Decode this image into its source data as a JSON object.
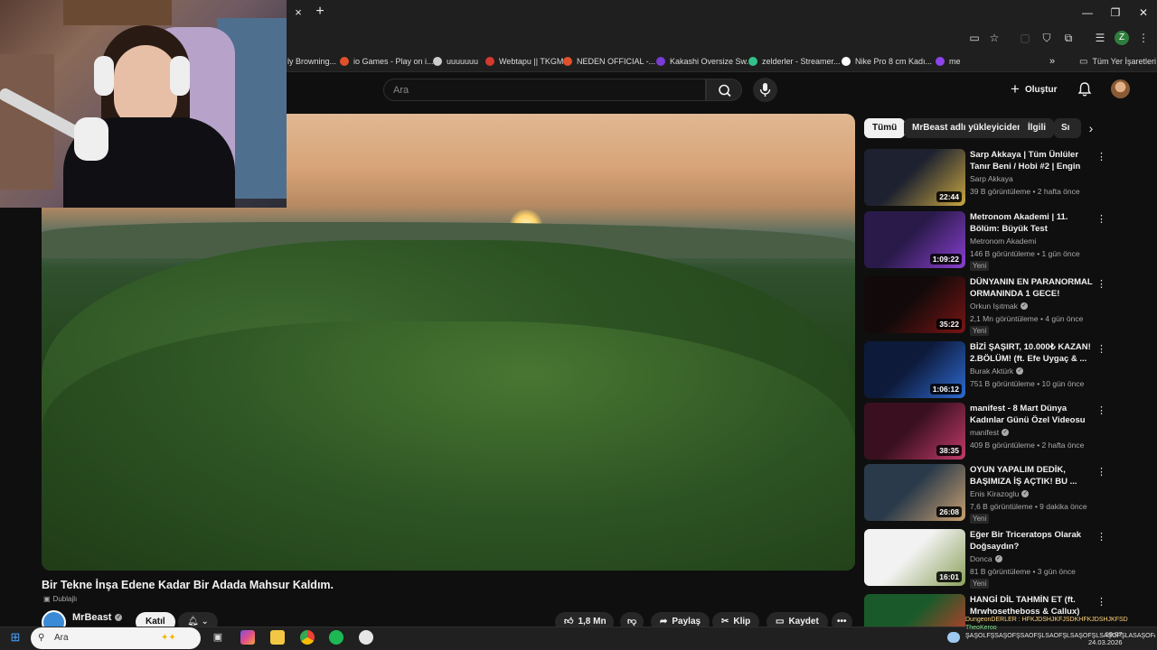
{
  "browser": {
    "tab_close": "×",
    "tab_new": "+",
    "bookmarks": [
      {
        "label": "ly Browning...",
        "color": "#777777"
      },
      {
        "label": "io Games - Play on i...",
        "color": "#e0502a"
      },
      {
        "label": "uuuuuuu",
        "color": "#cccccc"
      },
      {
        "label": "Webtapu || TKGM",
        "color": "#d33a2c"
      },
      {
        "label": "NEDEN OFFICIAL -...",
        "color": "#e0502a"
      },
      {
        "label": "Kakashi Oversize Sw...",
        "color": "#7a3bd6"
      },
      {
        "label": "zelderler - Streamer...",
        "color": "#35c08a"
      },
      {
        "label": "Nike Pro 8 cm Kadı...",
        "color": "#ffffff"
      },
      {
        "label": "me",
        "color": "#8e44ec"
      }
    ],
    "bookmarks_overflow": "»",
    "all_bookmarks": "Tüm Yer İşaretleri",
    "profile_initial": "Z"
  },
  "header": {
    "search_placeholder": "Ara",
    "create_label": "Oluştur"
  },
  "chips": [
    "Tümü",
    "MrBeast adlı yükleyiciden",
    "İlgili",
    "Sı"
  ],
  "recommendations": [
    {
      "title": "Sarp Akkaya | Tüm Ünlüler Tanır Beni / Hobi #2 | Engin Öztürk il...",
      "channel": "Sarp Akkaya",
      "verified": false,
      "meta": "39 B görüntüleme • 2 hafta önce",
      "badge": "",
      "duration": "22:44",
      "thumb_a": "#1e2230",
      "thumb_b": "#c9a640"
    },
    {
      "title": "Metronom Akademi | 11. Bölüm: Büyük Test",
      "channel": "Metronom Akademi",
      "verified": false,
      "meta": "146 B görüntüleme • 1 gün önce",
      "badge": "Yeni",
      "duration": "1:09:22",
      "thumb_a": "#2a1a4a",
      "thumb_b": "#8a3fd1"
    },
    {
      "title": "DÜNYANIN EN PARANORMAL ORMANINDA 1 GECE!",
      "channel": "Orkun Işıtmak",
      "verified": true,
      "meta": "2,1 Mn görüntüleme • 4 gün önce",
      "badge": "Yeni",
      "duration": "35:22",
      "thumb_a": "#120a0a",
      "thumb_b": "#7a1414"
    },
    {
      "title": "BİZİ ŞAŞIRT, 10.000₺ KAZAN! 2.BÖLÜM! (ft. Efe Uygaç & ...",
      "channel": "Burak Aktürk",
      "verified": true,
      "meta": "751 B görüntüleme • 10 gün önce",
      "badge": "",
      "duration": "1:06:12",
      "thumb_a": "#0d1a3a",
      "thumb_b": "#2e6ad1"
    },
    {
      "title": "manifest - 8 Mart Dünya Kadınlar Günü Özel Videosu",
      "channel": "manifest",
      "verified": true,
      "meta": "409 B görüntüleme • 2 hafta önce",
      "badge": "",
      "duration": "38:35",
      "thumb_a": "#3a1020",
      "thumb_b": "#c23a6a"
    },
    {
      "title": "OYUN YAPALIM DEDİK, BAŞIMIZA İŞ AÇTIK! BU ...",
      "channel": "Enis Kirazoglu",
      "verified": true,
      "meta": "7,6 B görüntüleme • 9 dakika önce",
      "badge": "Yeni",
      "duration": "26:08",
      "thumb_a": "#2a3a4a",
      "thumb_b": "#c8a070"
    },
    {
      "title": "Eğer Bir Triceratops Olarak Doğsaydın?",
      "channel": "Donca",
      "verified": true,
      "meta": "81 B görüntüleme • 3 gün önce",
      "badge": "Yeni",
      "duration": "16:01",
      "thumb_a": "#f2f2f2",
      "thumb_b": "#8aa05a"
    },
    {
      "title": "HANGİ DİL TAHMİN ET (ft. Mrwhosetheboss & Callux)",
      "channel": "",
      "verified": false,
      "meta": "",
      "badge": "",
      "duration": "",
      "thumb_a": "#1a5a2a",
      "thumb_b": "#d83a2a"
    }
  ],
  "video": {
    "title": "Bir Tekne İnşa Edene Kadar Bir Adada Mahsur Kaldım.",
    "dub_label": "Dublajlı",
    "channel": "MrBeast",
    "join_label": "Katıl",
    "likes": "1,8 Mn",
    "share_label": "Paylaş",
    "clip_label": "Klip",
    "save_label": "Kaydet"
  },
  "taskbar": {
    "search_placeholder": "Ara",
    "chat_line1": "DungeonDERLER : HFKJDSHJKFJSDKHFKJDSHJKFSD",
    "chat_line2": "TheoKeroo",
    "chat_line3": "ŞAŞÖLFŞSAŞÖFŞSAÖFŞLSAÖFŞLSAŞÖFŞLSAŞÖFŞLASAŞÖFASŞLFÖSAŞÖFŞLASAŞ",
    "time": "19:07",
    "date": "24.03.2026"
  }
}
